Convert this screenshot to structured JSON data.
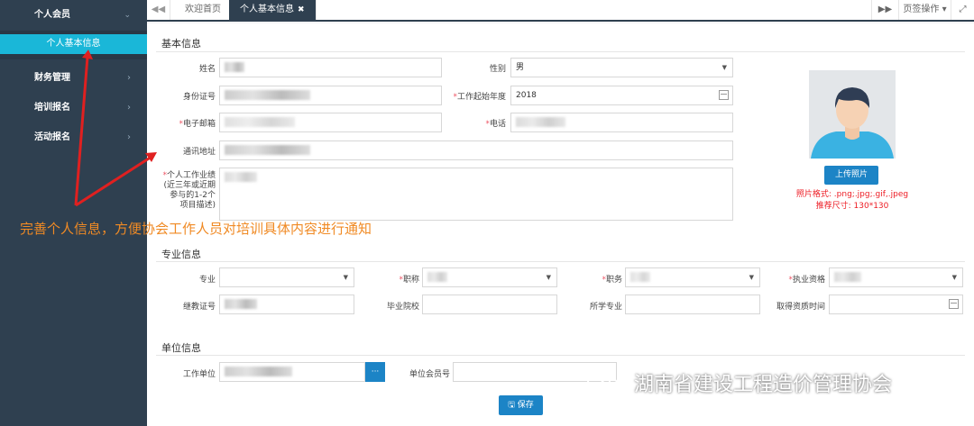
{
  "sidebar": {
    "member_label": "个人会员",
    "sub_item": "个人基本信息",
    "groups": [
      {
        "label": "财务管理"
      },
      {
        "label": "培训报名"
      },
      {
        "label": "活动报名"
      }
    ]
  },
  "tabs": {
    "home": "欢迎首页",
    "active": "个人基本信息",
    "close_icon": "✖",
    "page_ops": "页签操作"
  },
  "basic": {
    "title": "基本信息",
    "name_label": "姓名",
    "gender_label": "性别",
    "gender_value": "男",
    "id_label": "身份证号",
    "work_year_label": "工作起始年度",
    "work_year_value": "2018",
    "email_label": "电子邮箱",
    "phone_label": "电话",
    "address_label": "通讯地址",
    "performance_label_1": "个人工作业绩",
    "performance_label_2": "(近三年或近期",
    "performance_label_3": "参与的1-2个",
    "performance_label_4": "项目描述)",
    "upload_button": "上传照片",
    "photo_format": "照片格式: .png;.jpg;.gif,.jpeg",
    "photo_size": "推荐尺寸: 130*130"
  },
  "professional": {
    "title": "专业信息",
    "major_label": "专业",
    "title_label": "职称",
    "position_label": "职务",
    "qualification_label": "执业资格",
    "cert_label": "继教证号",
    "school_label": "毕业院校",
    "study_major_label": "所学专业",
    "qual_time_label": "取得资质时间"
  },
  "unit": {
    "title": "单位信息",
    "employer_label": "工作单位",
    "member_no_label": "单位会员号",
    "dots_button": "···",
    "save_button": "保存"
  },
  "annotation": {
    "text": "完善个人信息，方便协会工作人员对培训具体内容进行通知",
    "watermark": "湖南省建设工程造价管理协会"
  },
  "colors": {
    "sidebar_bg": "#2f4050",
    "active_sub": "#1ab7d8",
    "primary_button": "#1c84c6",
    "required": "#ed5565",
    "annotation": "#f08a24",
    "arrow": "#e02020"
  }
}
